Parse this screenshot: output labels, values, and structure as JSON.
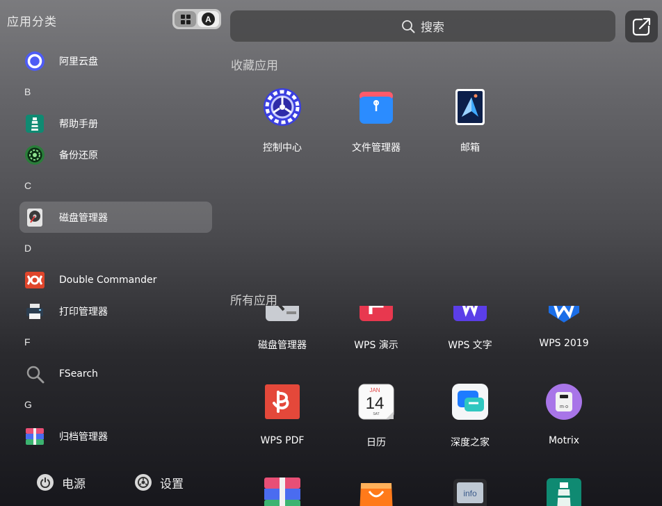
{
  "sidebar": {
    "title": "应用分类",
    "groups": [
      {
        "letter": "",
        "items": [
          {
            "label": "阿里云盘",
            "icon": "aliyun-drive-icon"
          }
        ]
      },
      {
        "letter": "B",
        "items": [
          {
            "label": "帮助手册",
            "icon": "help-manual-icon"
          },
          {
            "label": "备份还原",
            "icon": "backup-restore-icon"
          }
        ]
      },
      {
        "letter": "C",
        "items": [
          {
            "label": "磁盘管理器",
            "icon": "disk-manager-icon"
          }
        ]
      },
      {
        "letter": "D",
        "items": [
          {
            "label": "Double Commander",
            "icon": "double-commander-icon"
          },
          {
            "label": "打印管理器",
            "icon": "print-manager-icon"
          }
        ]
      },
      {
        "letter": "F",
        "items": [
          {
            "label": "FSearch",
            "icon": "fsearch-icon"
          }
        ]
      },
      {
        "letter": "G",
        "items": [
          {
            "label": "归档管理器",
            "icon": "archive-manager-icon"
          }
        ]
      }
    ],
    "selected": "磁盘管理器"
  },
  "footer": {
    "power_label": "电源",
    "settings_label": "设置"
  },
  "search": {
    "placeholder": "搜索"
  },
  "favorites": {
    "title": "收藏应用",
    "apps": [
      {
        "label": "控制中心",
        "icon": "control-center-icon"
      },
      {
        "label": "文件管理器",
        "icon": "file-manager-icon"
      },
      {
        "label": "邮箱",
        "icon": "mail-icon"
      }
    ]
  },
  "all_apps": {
    "title": "所有应用",
    "apps": [
      {
        "label": "磁盘管理器",
        "icon": "disk-manager-icon"
      },
      {
        "label": "WPS 演示",
        "icon": "wps-presentation-icon"
      },
      {
        "label": "WPS 文字",
        "icon": "wps-writer-icon"
      },
      {
        "label": "WPS 2019",
        "icon": "wps-2019-icon"
      },
      {
        "label": "WPS PDF",
        "icon": "wps-pdf-icon"
      },
      {
        "label": "日历",
        "icon": "calendar-icon"
      },
      {
        "label": "深度之家",
        "icon": "deepin-home-icon"
      },
      {
        "label": "Motrix",
        "icon": "motrix-icon"
      }
    ],
    "calendar": {
      "month": "JAN",
      "day": "14",
      "weekday": "SAT"
    },
    "info_badge": "info",
    "motrix_badge": "m·o"
  },
  "colors": {
    "accent": "#0081ff",
    "background_top": "#7b7b7e",
    "background_bottom": "#17171c"
  }
}
